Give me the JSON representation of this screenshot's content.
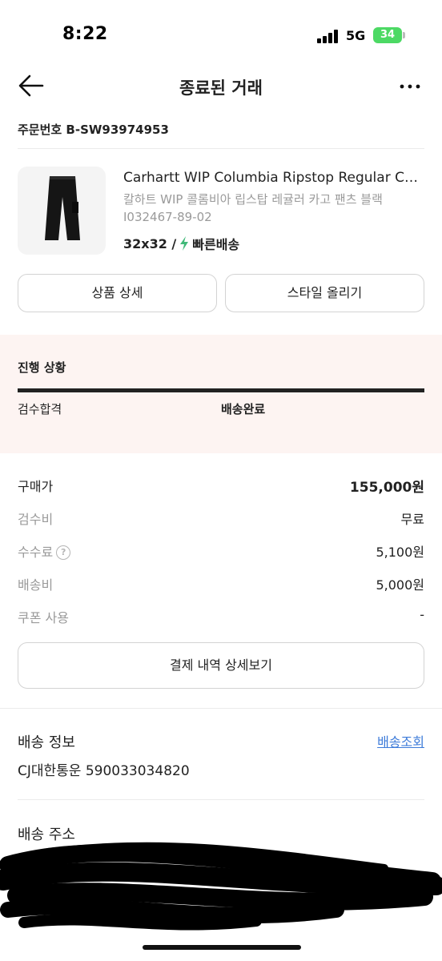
{
  "status_bar": {
    "time": "8:22",
    "network": "5G",
    "battery": "34"
  },
  "header": {
    "title": "종료된 거래",
    "back_icon": "arrow-left-icon",
    "more_icon": "ellipsis-icon"
  },
  "order": {
    "number_label": "주문번호 B-SW93974953"
  },
  "product": {
    "name": "Carhartt WIP Columbia Ripstop Regular Cargo Pants Black",
    "name_ko": "칼하트 WIP 콜롬비아 립스탑 레귤러 카고 팬츠 블랙",
    "code": "I032467-89-02",
    "size": "32x32 /",
    "shipping": "빠른배송",
    "shipping_color": "#41b979"
  },
  "actions": {
    "detail_label": "상품 상세",
    "style_label": "스타일 올리기"
  },
  "progress": {
    "title": "진행 상황",
    "steps": [
      {
        "label": "검수합격",
        "active": false
      },
      {
        "label": "배송완료",
        "active": true
      }
    ],
    "panel_color": "#fdf4f2"
  },
  "price": {
    "rows": [
      {
        "label": "구매가",
        "value": "155,000원"
      },
      {
        "label": "검수비",
        "value": "무료"
      },
      {
        "label": "수수료",
        "value": "5,100원"
      },
      {
        "label": "배송비",
        "value": "5,000원"
      },
      {
        "label": "쿠폰 사용",
        "value": "-"
      }
    ],
    "detail_button": "결제 내역 상세보기"
  },
  "delivery": {
    "title": "배송 정보",
    "tracking_link": "배송조회",
    "courier": "CJ대한통운 590033034820",
    "link_color": "#3d7bd9"
  },
  "address": {
    "title": "배송 주소"
  }
}
